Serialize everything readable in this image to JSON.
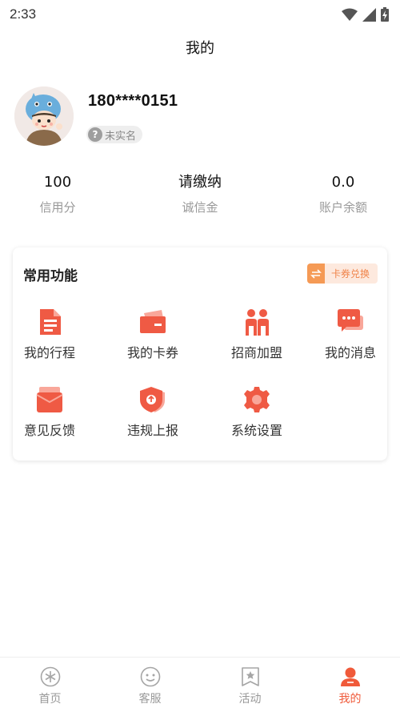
{
  "status_bar": {
    "time": "2:33"
  },
  "header": {
    "title": "我的"
  },
  "profile": {
    "phone": "180****0151",
    "realname_badge": "未实名"
  },
  "stats": [
    {
      "value": "100",
      "label": "信用分"
    },
    {
      "value": "请缴纳",
      "label": "诚信金"
    },
    {
      "value": "0.0",
      "label": "账户余额"
    }
  ],
  "features_card": {
    "title": "常用功能",
    "coupon_button": "卡券兑换",
    "items": [
      {
        "label": "我的行程",
        "icon": "document-icon"
      },
      {
        "label": "我的卡券",
        "icon": "card-icon"
      },
      {
        "label": "招商加盟",
        "icon": "people-icon"
      },
      {
        "label": "我的消息",
        "icon": "message-icon"
      },
      {
        "label": "意见反馈",
        "icon": "feedback-icon"
      },
      {
        "label": "违规上报",
        "icon": "shield-upload-icon"
      },
      {
        "label": "系统设置",
        "icon": "gear-icon"
      }
    ]
  },
  "tabbar": [
    {
      "label": "首页",
      "icon": "home-icon",
      "active": false
    },
    {
      "label": "客服",
      "icon": "smile-icon",
      "active": false
    },
    {
      "label": "活动",
      "icon": "bookmark-star-icon",
      "active": false
    },
    {
      "label": "我的",
      "icon": "user-icon",
      "active": true
    }
  ],
  "colors": {
    "accent": "#f05a3a",
    "icon_red": "#ef5a44",
    "icon_light": "#f9a79a",
    "coupon_orange": "#f59a55",
    "inactive_tab": "#999999"
  }
}
